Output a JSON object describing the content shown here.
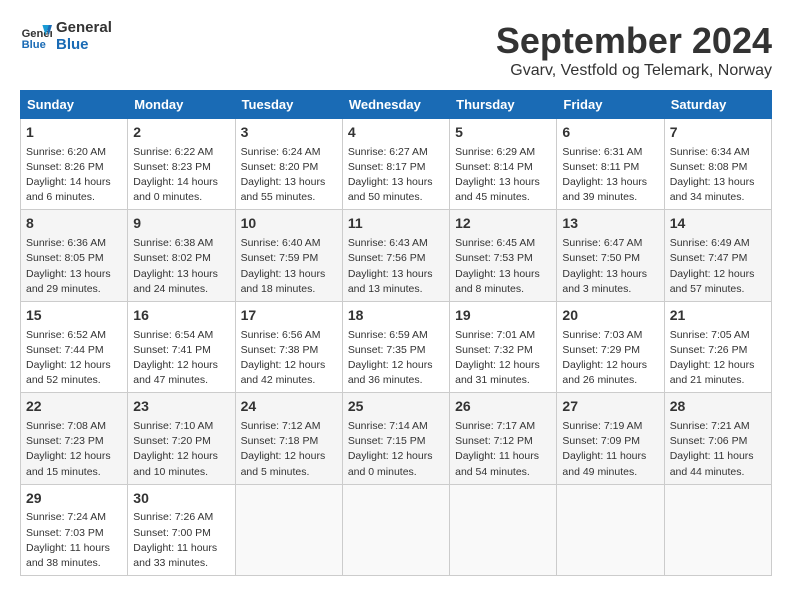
{
  "header": {
    "logo_line1": "General",
    "logo_line2": "Blue",
    "month_title": "September 2024",
    "location": "Gvarv, Vestfold og Telemark, Norway"
  },
  "weekdays": [
    "Sunday",
    "Monday",
    "Tuesday",
    "Wednesday",
    "Thursday",
    "Friday",
    "Saturday"
  ],
  "weeks": [
    [
      {
        "day": "1",
        "info": "Sunrise: 6:20 AM\nSunset: 8:26 PM\nDaylight: 14 hours and 6 minutes."
      },
      {
        "day": "2",
        "info": "Sunrise: 6:22 AM\nSunset: 8:23 PM\nDaylight: 14 hours and 0 minutes."
      },
      {
        "day": "3",
        "info": "Sunrise: 6:24 AM\nSunset: 8:20 PM\nDaylight: 13 hours and 55 minutes."
      },
      {
        "day": "4",
        "info": "Sunrise: 6:27 AM\nSunset: 8:17 PM\nDaylight: 13 hours and 50 minutes."
      },
      {
        "day": "5",
        "info": "Sunrise: 6:29 AM\nSunset: 8:14 PM\nDaylight: 13 hours and 45 minutes."
      },
      {
        "day": "6",
        "info": "Sunrise: 6:31 AM\nSunset: 8:11 PM\nDaylight: 13 hours and 39 minutes."
      },
      {
        "day": "7",
        "info": "Sunrise: 6:34 AM\nSunset: 8:08 PM\nDaylight: 13 hours and 34 minutes."
      }
    ],
    [
      {
        "day": "8",
        "info": "Sunrise: 6:36 AM\nSunset: 8:05 PM\nDaylight: 13 hours and 29 minutes."
      },
      {
        "day": "9",
        "info": "Sunrise: 6:38 AM\nSunset: 8:02 PM\nDaylight: 13 hours and 24 minutes."
      },
      {
        "day": "10",
        "info": "Sunrise: 6:40 AM\nSunset: 7:59 PM\nDaylight: 13 hours and 18 minutes."
      },
      {
        "day": "11",
        "info": "Sunrise: 6:43 AM\nSunset: 7:56 PM\nDaylight: 13 hours and 13 minutes."
      },
      {
        "day": "12",
        "info": "Sunrise: 6:45 AM\nSunset: 7:53 PM\nDaylight: 13 hours and 8 minutes."
      },
      {
        "day": "13",
        "info": "Sunrise: 6:47 AM\nSunset: 7:50 PM\nDaylight: 13 hours and 3 minutes."
      },
      {
        "day": "14",
        "info": "Sunrise: 6:49 AM\nSunset: 7:47 PM\nDaylight: 12 hours and 57 minutes."
      }
    ],
    [
      {
        "day": "15",
        "info": "Sunrise: 6:52 AM\nSunset: 7:44 PM\nDaylight: 12 hours and 52 minutes."
      },
      {
        "day": "16",
        "info": "Sunrise: 6:54 AM\nSunset: 7:41 PM\nDaylight: 12 hours and 47 minutes."
      },
      {
        "day": "17",
        "info": "Sunrise: 6:56 AM\nSunset: 7:38 PM\nDaylight: 12 hours and 42 minutes."
      },
      {
        "day": "18",
        "info": "Sunrise: 6:59 AM\nSunset: 7:35 PM\nDaylight: 12 hours and 36 minutes."
      },
      {
        "day": "19",
        "info": "Sunrise: 7:01 AM\nSunset: 7:32 PM\nDaylight: 12 hours and 31 minutes."
      },
      {
        "day": "20",
        "info": "Sunrise: 7:03 AM\nSunset: 7:29 PM\nDaylight: 12 hours and 26 minutes."
      },
      {
        "day": "21",
        "info": "Sunrise: 7:05 AM\nSunset: 7:26 PM\nDaylight: 12 hours and 21 minutes."
      }
    ],
    [
      {
        "day": "22",
        "info": "Sunrise: 7:08 AM\nSunset: 7:23 PM\nDaylight: 12 hours and 15 minutes."
      },
      {
        "day": "23",
        "info": "Sunrise: 7:10 AM\nSunset: 7:20 PM\nDaylight: 12 hours and 10 minutes."
      },
      {
        "day": "24",
        "info": "Sunrise: 7:12 AM\nSunset: 7:18 PM\nDaylight: 12 hours and 5 minutes."
      },
      {
        "day": "25",
        "info": "Sunrise: 7:14 AM\nSunset: 7:15 PM\nDaylight: 12 hours and 0 minutes."
      },
      {
        "day": "26",
        "info": "Sunrise: 7:17 AM\nSunset: 7:12 PM\nDaylight: 11 hours and 54 minutes."
      },
      {
        "day": "27",
        "info": "Sunrise: 7:19 AM\nSunset: 7:09 PM\nDaylight: 11 hours and 49 minutes."
      },
      {
        "day": "28",
        "info": "Sunrise: 7:21 AM\nSunset: 7:06 PM\nDaylight: 11 hours and 44 minutes."
      }
    ],
    [
      {
        "day": "29",
        "info": "Sunrise: 7:24 AM\nSunset: 7:03 PM\nDaylight: 11 hours and 38 minutes."
      },
      {
        "day": "30",
        "info": "Sunrise: 7:26 AM\nSunset: 7:00 PM\nDaylight: 11 hours and 33 minutes."
      },
      {
        "day": "",
        "info": ""
      },
      {
        "day": "",
        "info": ""
      },
      {
        "day": "",
        "info": ""
      },
      {
        "day": "",
        "info": ""
      },
      {
        "day": "",
        "info": ""
      }
    ]
  ]
}
